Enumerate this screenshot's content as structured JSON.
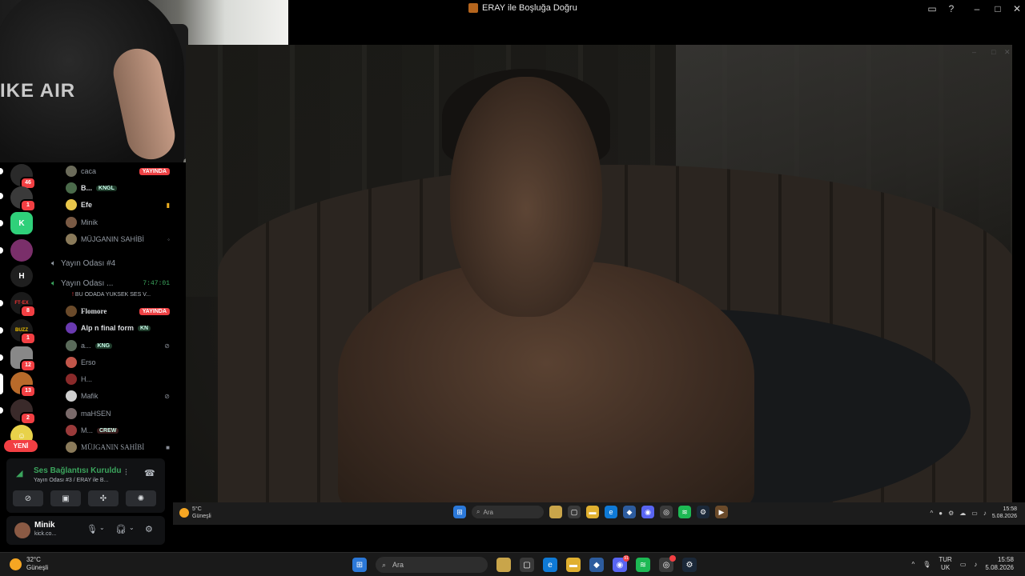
{
  "window": {
    "title": "ERAY ile Boşluğa Doğru",
    "icons": [
      "minimize-icon",
      "maximize-icon",
      "close-icon"
    ]
  },
  "webcam": {
    "shirt_text": "IKE AIR",
    "small_logo_text": "AIR"
  },
  "discord": {
    "guild_badges": [
      "46",
      "1",
      "8",
      "1",
      "12",
      "13",
      "2"
    ],
    "guild_letter": "H",
    "guild_text_ftr": "FT·EX",
    "guild_text_buzz": "BUZZ",
    "new_label": "YENİ",
    "members_top": [
      {
        "name": "caca",
        "live": "YAYINDA"
      },
      {
        "name": "B...",
        "tag": "KNGL"
      },
      {
        "name": "Efe"
      },
      {
        "name": "Minik"
      },
      {
        "name": "MÜJGANIN SAHİBİ"
      }
    ],
    "channel4": "Yayın Odası #4",
    "channel3": {
      "name": "Yayın Odası ...",
      "timer": "7:47:01",
      "warning": "BU ODADA YÜKSEK SES V..."
    },
    "members_bottom": [
      {
        "name": "Flomore",
        "live": "YAYINDA"
      },
      {
        "name": "Alp n final form",
        "tag": "KN"
      },
      {
        "name": "a...",
        "tag": "KNG"
      },
      {
        "name": "Erso"
      },
      {
        "name": "H..."
      },
      {
        "name": "Mafik"
      },
      {
        "name": "maHSEN"
      },
      {
        "name": "M...",
        "tag": "CREW"
      },
      {
        "name": "MÜJGANIN SAHİBİ"
      }
    ],
    "voice": {
      "status": "Ses Bağlantısı Kuruldu",
      "subtitle": "Yayın Odası #3 / ERAY ile B..."
    },
    "user": {
      "name": "Minik",
      "status": "kick.co..."
    }
  },
  "inner_taskbar": {
    "temp": "5°C",
    "weather": "Güneşli",
    "search": "Ara",
    "time": "15:58",
    "date": "5.08.2026"
  },
  "taskbar": {
    "temp": "32°C",
    "weather": "Güneşli",
    "search": "Ara",
    "lang": "TUR",
    "region": "UK",
    "time": "15:58",
    "date": "5.08.2026",
    "discord_badge": "91"
  }
}
